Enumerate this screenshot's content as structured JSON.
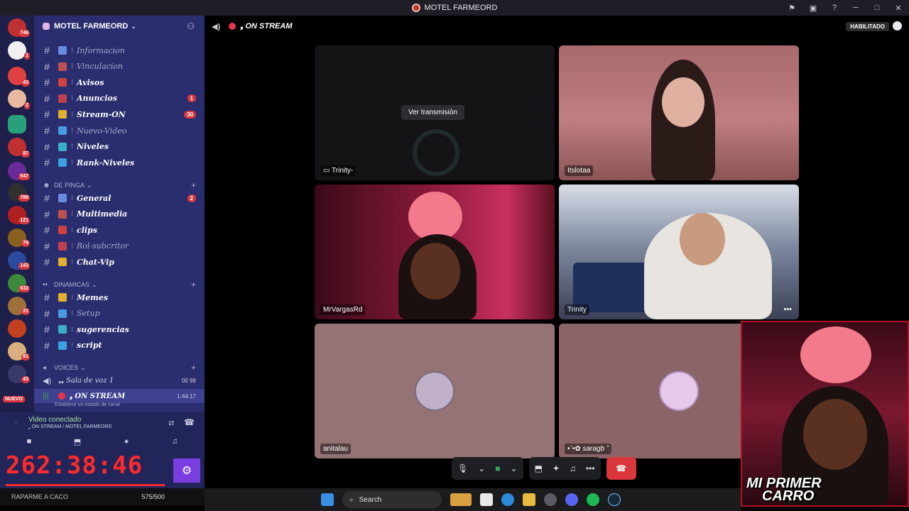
{
  "window": {
    "title": "MOTEL FARMEORD"
  },
  "rail": {
    "badges": [
      "746",
      "1",
      "43",
      "2",
      "87",
      "547",
      "789",
      "121",
      "79",
      "143",
      "632",
      "21",
      "61",
      "43",
      "41"
    ],
    "new_label": "NUEVO"
  },
  "server": {
    "name": "MOTEL FARMEORD"
  },
  "channels_top": [
    {
      "name": "Informacion",
      "muted": true
    },
    {
      "name": "Vinculacion",
      "muted": true
    },
    {
      "name": "Avisos",
      "muted": false
    },
    {
      "name": "Anuncios",
      "muted": false,
      "count": "1"
    },
    {
      "name": "Stream-ON",
      "muted": false,
      "count": "30"
    },
    {
      "name": "Nuevo-Video",
      "muted": true
    },
    {
      "name": "Niveles",
      "muted": false
    },
    {
      "name": "Rank-Niveles",
      "muted": false
    }
  ],
  "category_pinga": {
    "label": "DE PINGA"
  },
  "channels_pinga": [
    {
      "name": "General",
      "muted": false,
      "count": "2"
    },
    {
      "name": "Multimedia",
      "muted": false
    },
    {
      "name": "clips",
      "muted": false
    },
    {
      "name": "Rol-subcritor",
      "muted": true
    },
    {
      "name": "Chat-Vip",
      "muted": false
    }
  ],
  "category_dinamicas": {
    "label": "DINAMICAS"
  },
  "channels_dinamicas": [
    {
      "name": "Memes",
      "muted": false
    },
    {
      "name": "Setup",
      "muted": true
    },
    {
      "name": "sugerencias",
      "muted": false
    },
    {
      "name": "script",
      "muted": false
    }
  ],
  "category_voices": {
    "label": "VOICES"
  },
  "voice_channels": [
    {
      "name": "❟❟ Sala de voz 1",
      "right": "00 99"
    },
    {
      "name": "❟ ON STREAM",
      "right": "1:44:17",
      "status": "Establece un estado de canal"
    }
  ],
  "user_panel": {
    "connected": "Video conectado",
    "location": "❟ ON STREAM / MOTEL FARMEORD",
    "timer": "262:38:46",
    "progress": 1.0
  },
  "footer": {
    "left": "RAPARME A CACO",
    "right": "575/500"
  },
  "stage": {
    "channel": "❟ ON STREAM",
    "habilitado": "HABILITADO"
  },
  "tiles": {
    "t1": {
      "label": "Trinity-",
      "button": "Ver transmisión"
    },
    "t2": {
      "label": "Itslotaa"
    },
    "t3": {
      "label": "MrVargasRd"
    },
    "t4": {
      "label": "Trinity"
    },
    "t5": {
      "label": "anitalau"
    },
    "t6": {
      "label": "•¨•✿ saragb ˜"
    }
  },
  "overlay": {
    "logo_line1": "MI PRIMER",
    "logo_line2": "CARRO"
  },
  "taskbar": {
    "search": "Search"
  },
  "colors": {
    "sidebar": "#2a2d6e",
    "rail": "#1e1f4a",
    "accent": "#da373c",
    "timer": "#ff2a2a"
  }
}
